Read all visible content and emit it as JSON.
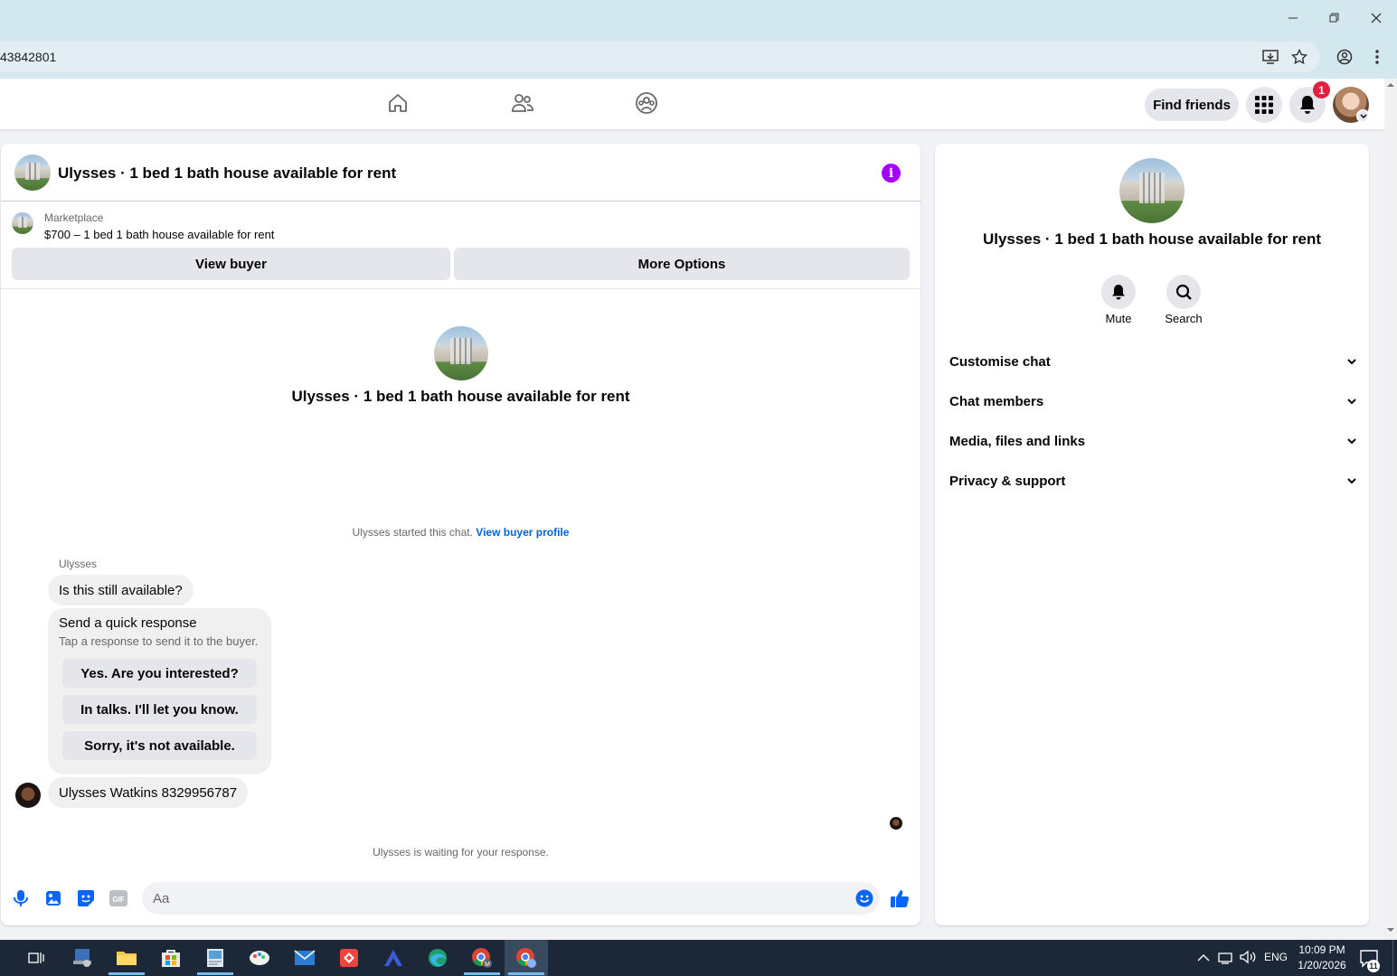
{
  "browser": {
    "url_fragment": "43842801"
  },
  "fb_header": {
    "find_friends_label": "Find friends",
    "notification_count": "1"
  },
  "chat": {
    "title": "Ulysses · 1 bed 1 bath house available for rent",
    "listing": {
      "source_label": "Marketplace",
      "price_title": "$700 – 1 bed 1 bath house available for rent"
    },
    "buttons": {
      "view_buyer": "View buyer",
      "more_options": "More Options"
    },
    "center_title": "Ulysses · 1 bed 1 bath house available for rent",
    "started_text": "Ulysses started this chat.",
    "view_buyer_profile_link": "View buyer profile",
    "sender_name": "Ulysses",
    "message_1": "Is this still available?",
    "quick_response": {
      "title": "Send a quick response",
      "subtitle": "Tap a response to send it to the buyer.",
      "options": [
        "Yes. Are you interested?",
        "In talks. I'll let you know.",
        "Sorry, it's not available."
      ]
    },
    "message_2": "Ulysses Watkins 8329956787",
    "waiting_text": "Ulysses is waiting for your response.",
    "composer_placeholder": "Aa"
  },
  "right_panel": {
    "title": "Ulysses · 1 bed 1 bath house available for rent",
    "mute_label": "Mute",
    "search_label": "Search",
    "sections": [
      "Customise chat",
      "Chat members",
      "Media, files and links",
      "Privacy & support"
    ]
  },
  "taskbar": {
    "language": "ENG",
    "time": "10:09 PM",
    "date": "1/20/2026",
    "notification_count": "11"
  },
  "colors": {
    "accent_blue": "#0064d1",
    "info_purple": "#a200ff",
    "badge_red": "#e41e3f",
    "chrome_bg": "#d3e7ee"
  }
}
